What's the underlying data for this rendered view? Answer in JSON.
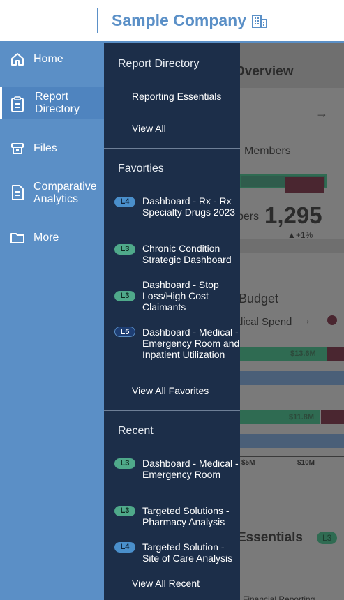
{
  "header": {
    "company": "Sample Company",
    "icon": "building-icon"
  },
  "nav": {
    "items": [
      {
        "label": "Home",
        "icon": "home-icon"
      },
      {
        "label": "Report Directory",
        "icon": "clipboard-icon",
        "active": true
      },
      {
        "label": "Files",
        "icon": "files-icon"
      },
      {
        "label": "Comparative Analytics",
        "icon": "document-icon"
      },
      {
        "label": "More",
        "icon": "folder-icon"
      }
    ]
  },
  "flyout": {
    "report_directory": {
      "title": "Report Directory",
      "links": [
        "Reporting Essentials",
        "View All"
      ]
    },
    "favorites": {
      "title": "Favorties",
      "items": [
        {
          "badge": "L4",
          "text": "Dashboard - Rx - Rx Specialty Drugs 2023"
        },
        {
          "badge": "L3",
          "text": "Chronic Condition Strategic Dashboard"
        },
        {
          "badge": "L3",
          "text": "Dashboard - Stop Loss/High Cost Claimants"
        },
        {
          "badge": "L5",
          "text": "Dashboard - Medical - Emergency Room and Inpatient Utilization"
        }
      ],
      "view_all": "View All Favorites"
    },
    "recent": {
      "title": "Recent",
      "items": [
        {
          "badge": "L3",
          "text": "Dashboard - Medical - Emergency Room"
        },
        {
          "badge": "L3",
          "text": "Targeted Solutions - Pharmacy Analysis"
        },
        {
          "badge": "L4",
          "text": "Targeted Solution - Site of Care Analysis"
        }
      ],
      "view_all": "View All Recent"
    }
  },
  "background": {
    "overview_title": "Overview",
    "members_label": "Members",
    "members_partial": "bers",
    "members_value": "1,295",
    "members_change": "▲+1%",
    "budget_title": "Budget",
    "medical_spend": "dical Spend",
    "bar1_label": "$13.6M",
    "bar2_label": "$11.8M",
    "axis1": "$5M",
    "axis2": "$10M",
    "essentials_title": "Essentials",
    "essentials_badge": "L3",
    "financial": "Financial Reporting"
  }
}
